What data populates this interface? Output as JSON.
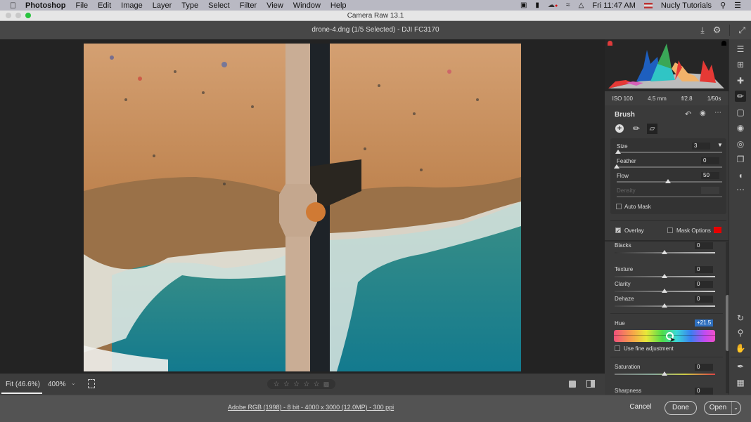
{
  "menubar": {
    "apple_icon": "apple-icon",
    "app_name": "Photoshop",
    "items": [
      "File",
      "Edit",
      "Image",
      "Layer",
      "Type",
      "Select",
      "Filter",
      "View",
      "Window",
      "Help"
    ],
    "clock": "Fri 11:47 AM",
    "user": "Nucly Tutorials",
    "status_icons": [
      "screen-record-icon",
      "battery-icon",
      "creative-cloud-icon",
      "wifi-icon",
      "airplay-icon",
      "flag-icon",
      "search-icon",
      "list-icon"
    ]
  },
  "window": {
    "title": "Camera Raw 13.1"
  },
  "doc_header": {
    "filename": "drone-4.dng (1/5 Selected)  -  DJI FC3170",
    "icons": [
      "save-icon",
      "settings-icon",
      "fullscreen-icon"
    ]
  },
  "histogram": {
    "shadow_clip_color": "#e03b3b",
    "exif": {
      "iso": "ISO 100",
      "focal": "4.5 mm",
      "aperture": "f/2.8",
      "shutter": "1/50s"
    }
  },
  "brush": {
    "title": "Brush",
    "header_icons": [
      "reset-icon",
      "visibility-icon",
      "more-icon"
    ],
    "modes": [
      "add-icon",
      "brush-icon",
      "eraser-icon"
    ],
    "size": {
      "label": "Size",
      "value": "3",
      "position": 0.02
    },
    "feather": {
      "label": "Feather",
      "value": "0",
      "position": 0.0
    },
    "flow": {
      "label": "Flow",
      "value": "50",
      "position": 0.5
    },
    "density": {
      "label": "Density",
      "value": ""
    },
    "auto_mask": {
      "label": "Auto Mask",
      "checked": false
    },
    "overlay": {
      "label": "Overlay",
      "checked": true
    },
    "mask_options": {
      "label": "Mask Options",
      "checked": false,
      "color": "#e60000"
    }
  },
  "adjustments": {
    "blacks": {
      "label": "Blacks",
      "value": "0"
    },
    "texture": {
      "label": "Texture",
      "value": "0"
    },
    "clarity": {
      "label": "Clarity",
      "value": "0"
    },
    "dehaze": {
      "label": "Dehaze",
      "value": "0"
    },
    "hue": {
      "label": "Hue",
      "value": "+21.5",
      "position": 0.55
    },
    "fine_adjust": {
      "label": "Use fine adjustment",
      "checked": false
    },
    "saturation": {
      "label": "Saturation",
      "value": "0"
    },
    "sharpness": {
      "label": "Sharpness",
      "value": "0"
    }
  },
  "tools": [
    "edit-icon",
    "crop-icon",
    "heal-icon",
    "brush-icon",
    "linear-gradient-icon",
    "radial-filter-icon",
    "red-eye-icon",
    "snapshots-icon",
    "presets-icon",
    "more-icon",
    "rotate-icon",
    "zoom-icon",
    "hand-icon",
    "sampler-icon",
    "grid-icon"
  ],
  "bottom_bar": {
    "fit": "Fit (46.6%)",
    "zoom": "400%",
    "rating_stars": 0,
    "star_count": 5
  },
  "footer": {
    "info_link": "Adobe RGB (1998) - 8 bit - 4000 x 3000 (12.0MP) - 300 ppi",
    "cancel": "Cancel",
    "done": "Done",
    "open": "Open"
  }
}
